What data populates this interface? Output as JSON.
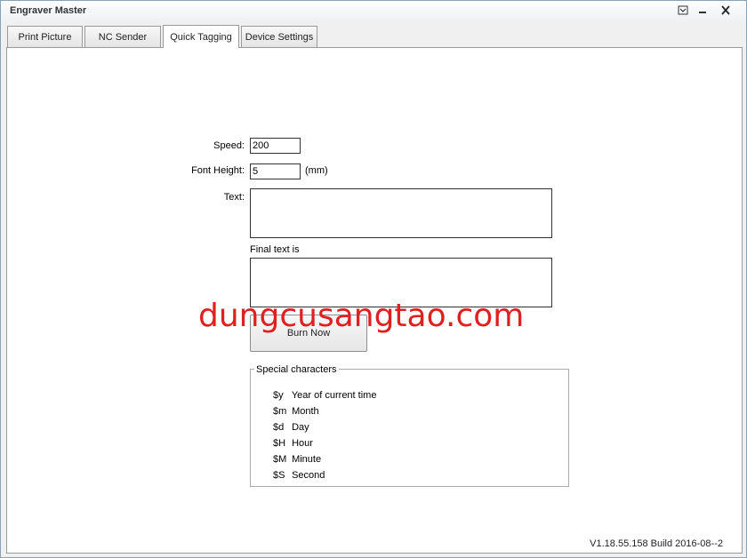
{
  "window": {
    "title": "Engraver Master"
  },
  "tabs": [
    {
      "label": "Print Picture",
      "active": false
    },
    {
      "label": "NC Sender",
      "active": false
    },
    {
      "label": "Quick Tagging",
      "active": true
    },
    {
      "label": "Device Settings",
      "active": false
    }
  ],
  "form": {
    "speed_label": "Speed:",
    "speed_value": "200",
    "font_height_label": "Font Height:",
    "font_height_value": "5",
    "font_height_unit": "(mm)",
    "text_label": "Text:",
    "text_value": "",
    "final_text_label": "Final text is",
    "final_text_value": "",
    "burn_button": "Burn Now"
  },
  "special_characters": {
    "title": "Special characters",
    "items": [
      {
        "code": "$y",
        "description": "Year of current time"
      },
      {
        "code": "$m",
        "description": "Month"
      },
      {
        "code": "$d",
        "description": "Day"
      },
      {
        "code": "$H",
        "description": "Hour"
      },
      {
        "code": "$M",
        "description": "Minute"
      },
      {
        "code": "$S",
        "description": "Second"
      }
    ]
  },
  "watermark": "dungcusangtao.com",
  "version": "V1.18.55.158 Build 2016-08--2",
  "colors": {
    "watermark": "#e0201f",
    "panel_background": "#ffffff",
    "window_background": "#f0f0f0"
  }
}
